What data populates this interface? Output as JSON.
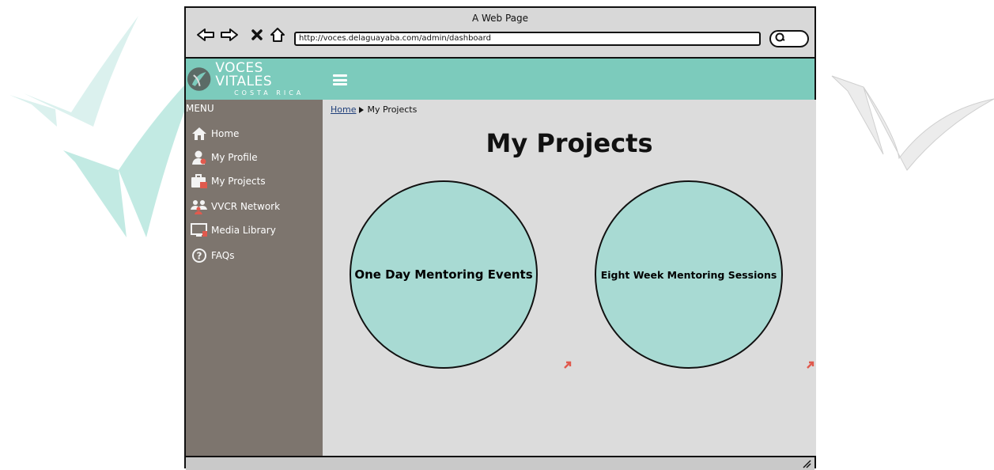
{
  "window": {
    "title": "A Web Page"
  },
  "address_bar": {
    "url": "http://voces.delaguayaba.com/admin/dashboard"
  },
  "icons": {
    "back": "back-arrow-icon",
    "forward": "forward-arrow-icon",
    "stop": "close-icon",
    "home": "home-outline-icon",
    "search": "search-icon",
    "menu": "hamburger-icon"
  },
  "logo": {
    "main": "VOCES VITALES",
    "sub": "COSTA RICA"
  },
  "sidebar": {
    "menu_label": "MENU",
    "items": [
      {
        "label": "Home",
        "icon": "home-icon"
      },
      {
        "label": "My Profile",
        "icon": "user-icon"
      },
      {
        "label": "My Projects",
        "icon": "briefcase-icon"
      },
      {
        "label": "VVCR Network",
        "icon": "group-icon"
      },
      {
        "label": "Media Library",
        "icon": "monitor-icon"
      },
      {
        "label": "FAQs",
        "icon": "help-icon"
      }
    ]
  },
  "breadcrumb": {
    "home": "Home",
    "current": "My Projects"
  },
  "main": {
    "title": "My Projects",
    "projects": [
      {
        "label": "One Day Mentoring Events"
      },
      {
        "label": "Eight Week Mentoring Sessions"
      }
    ]
  },
  "colors": {
    "header": "#7ccbbc",
    "sidebar": "#7d756e",
    "circle_fill": "#a8dad3",
    "content_bg": "#dcdcdc",
    "accent_red": "#e05a4e"
  }
}
